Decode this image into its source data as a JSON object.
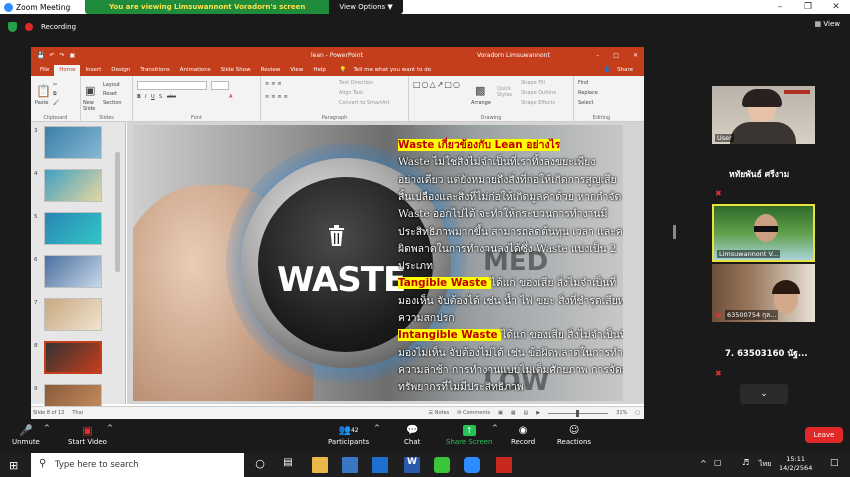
{
  "window": {
    "title": "Zoom Meeting"
  },
  "share_banner": {
    "message": "You are viewing Limsuwannont Voradorn's screen",
    "view_options": "View Options"
  },
  "meeting": {
    "recording": "Recording",
    "view": "View"
  },
  "ppt": {
    "file_name": "lean  -  PowerPoint",
    "user": "Voradorn Limsuwannont",
    "tabs": [
      "File",
      "Home",
      "Insert",
      "Design",
      "Transitions",
      "Animations",
      "Slide Show",
      "Review",
      "View",
      "Help"
    ],
    "tell_me": "Tell me what you want to do",
    "share": "Share",
    "ribbon_groups": [
      "Clipboard",
      "Slides",
      "Font",
      "Paragraph",
      "Drawing",
      "Editing"
    ],
    "ribbon_labels": {
      "paste": "Paste",
      "new_slide": "New Slide",
      "layout": "Layout",
      "reset": "Reset",
      "section": "Section",
      "text_direction": "Text Direction",
      "align_text": "Align Text",
      "smartart": "Convert to SmartArt",
      "arrange": "Arrange",
      "quick_styles": "Quick Styles",
      "shape_fill": "Shape Fill",
      "shape_outline": "Shape Outline",
      "shape_effects": "Shape Effects",
      "find": "Find",
      "replace": "Replace",
      "select": "Select"
    },
    "thumbnails": [
      {
        "num": "3",
        "colors": [
          "#3a7fa8",
          "#88b8d3"
        ]
      },
      {
        "num": "4",
        "colors": [
          "#3fa0c4",
          "#e6d6a0"
        ]
      },
      {
        "num": "5",
        "colors": [
          "#2a86b5",
          "#33c5c5"
        ]
      },
      {
        "num": "6",
        "colors": [
          "#4a6fa0",
          "#c8d8e8"
        ]
      },
      {
        "num": "7",
        "colors": [
          "#c8a880",
          "#f0e4d0"
        ]
      },
      {
        "num": "8",
        "colors": [
          "#333333",
          "#c43e1c"
        ]
      },
      {
        "num": "9",
        "colors": [
          "#8a5a3a",
          "#c89060"
        ]
      }
    ],
    "selected_thumb": 5,
    "status_left": "Slide 8 of 13",
    "status_lang": "Thai",
    "notes": "Notes",
    "comments": "Comments",
    "zoom": "31%"
  },
  "slide": {
    "knob_word": "WASTE",
    "dial_med": "MED",
    "dial_low": "LOW",
    "lines": [
      {
        "hl": "Waste เกี่ยวข้องกับ Lean อย่างไร",
        "text": ""
      },
      {
        "hl": "",
        "text": "Waste ไม่ใช่สิ่งไม่จำเป็นที่เราทิ้งลงขยะเพียง"
      },
      {
        "hl": "",
        "text": "อย่างเดียว แต่ยังหมายถึงสิ่งที่ก่อให้เกิดการสูญเสีย"
      },
      {
        "hl": "",
        "text": "สิ้นเปลืองและสิ่งที่ไม่ก่อให้เกิดมูลค่าด้วย หากกำจัด"
      },
      {
        "hl": "",
        "text": "Waste       ออกไปได้ จะทำให้กระบวนการทำงานมี"
      },
      {
        "hl": "",
        "text": "ประสิทธิภาพมากขึ้น สามารถลดต้นทุน เวลา และความ"
      },
      {
        "hl": "",
        "text": "ผิดพลาดในการทำงานลงได้ซึ่ง Waste    แบ่งเป็น 2"
      },
      {
        "hl": "",
        "text": "ประเภท"
      },
      {
        "hl": "Tangible   Waste  ",
        "text": " ได้แก่ ของเสีย สิ่งไม่จำเป็นที่"
      },
      {
        "hl": "",
        "text": "มองเห็น จับต้องได้ เช่น น้ำ ไฟ ขยะ สิ่งที่ชำรุดเสียหาย"
      },
      {
        "hl": "",
        "text": "ความสกปรก"
      },
      {
        "hl": "Intangible  Waste ",
        "text": " ได้แก่ ของเสีย สิ่งไม่จำเป็นที่"
      },
      {
        "hl": "",
        "text": "มองไม่เห็น จับต้องไม่ได้ เช่น ข้อผิดพลาดในการทำงาน"
      },
      {
        "hl": "",
        "text": "ความล่าช้า การทำงานแบบไม่เต็มศักยภาพ การจัดการ"
      },
      {
        "hl": "",
        "text": "ทรัพยากรที่ไม่มีประสิทธิภาพ"
      }
    ]
  },
  "participants_panel": [
    {
      "label": "User",
      "big": false
    },
    {
      "label": "หทัยพันธ์ ศรีงาม",
      "big": true
    },
    {
      "label": "Limsuwannont V...",
      "big": false
    },
    {
      "label": "63500754 กุล...",
      "big": false
    },
    {
      "label": "7. 63503160 นัฐ...",
      "big": true
    }
  ],
  "toolbar": {
    "unmute": "Unmute",
    "start_video": "Start Video",
    "participants": "Participants",
    "participant_count": "42",
    "chat": "Chat",
    "share_screen": "Share Screen",
    "record": "Record",
    "reactions": "Reactions",
    "leave": "Leave"
  },
  "taskbar": {
    "search_placeholder": "Type here to search",
    "lang": "ไทย",
    "time": "15:11",
    "date": "14/2/2564"
  }
}
